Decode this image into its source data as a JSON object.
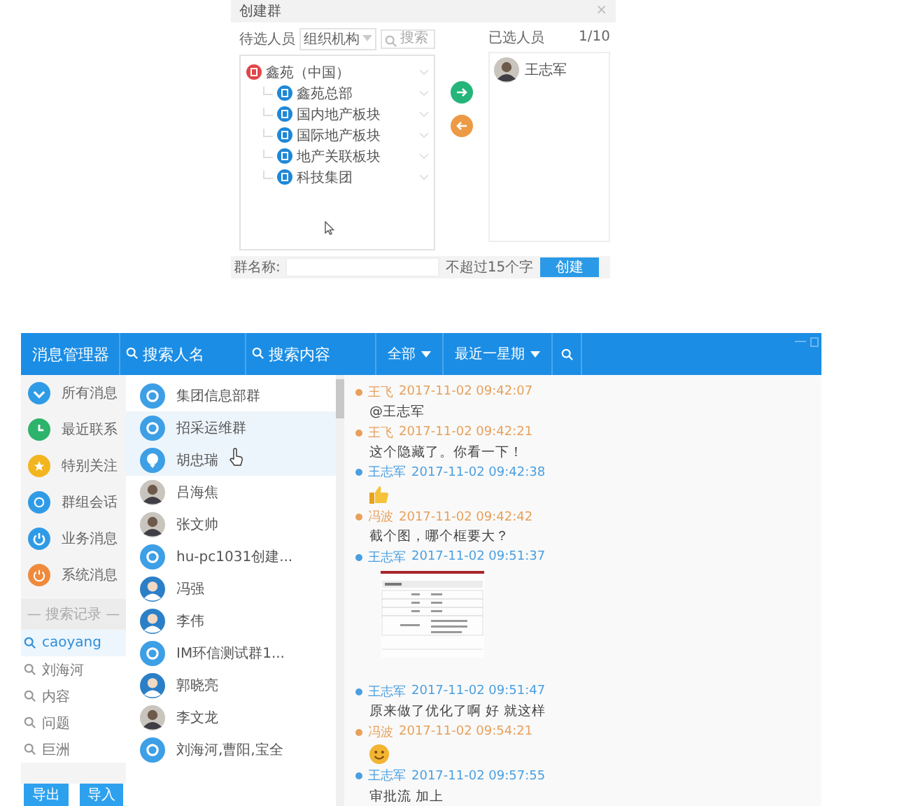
{
  "dialog": {
    "title": "创建群",
    "close": "×",
    "candidates_label": "待选人员",
    "org_select": "组织机构",
    "search": {
      "placeholder": "搜索"
    },
    "tree": [
      {
        "label": "鑫苑（中国）",
        "color": "#e0474c",
        "children": [
          {
            "label": "鑫苑总部",
            "color": "#1e88d8"
          },
          {
            "label": "国内地产板块",
            "color": "#1e88d8"
          },
          {
            "label": "国际地产板块",
            "color": "#1e88d8"
          },
          {
            "label": "地产关联板块",
            "color": "#1e88d8"
          },
          {
            "label": "科技集团",
            "color": "#1e88d8"
          }
        ]
      }
    ],
    "selected_label": "已选人员",
    "selected_count": "1/10",
    "selected_people": [
      {
        "name": "王志军"
      }
    ],
    "group_name_label": "群名称:",
    "group_name_hint": "不超过15个字",
    "create_button": "创建"
  },
  "app": {
    "title": "消息管理器",
    "search_name": {
      "placeholder": "搜索人名"
    },
    "search_content": {
      "placeholder": "搜索内容"
    },
    "filters": [
      {
        "label": "全部"
      },
      {
        "label": "最近一星期"
      }
    ],
    "nav": [
      {
        "label": "所有消息",
        "kind": "all",
        "color": "#2f9be6"
      },
      {
        "label": "最近联系",
        "kind": "recent",
        "color": "#2db36b"
      },
      {
        "label": "特别关注",
        "kind": "star",
        "color": "#f2b51f"
      },
      {
        "label": "群组会话",
        "kind": "group",
        "color": "#2f9be6"
      },
      {
        "label": "业务消息",
        "kind": "business",
        "color": "#2f9be6"
      },
      {
        "label": "系统消息",
        "kind": "system",
        "color": "#ef8a3c"
      }
    ],
    "history_title": "— 搜索记录 —",
    "history": [
      {
        "text": "caoyang",
        "selected": true
      },
      {
        "text": "刘海河",
        "selected": false
      },
      {
        "text": "内容",
        "selected": false
      },
      {
        "text": "问题",
        "selected": false
      },
      {
        "text": "巨洲",
        "selected": false
      }
    ],
    "buttons": [
      {
        "label": "导出"
      },
      {
        "label": "导入"
      }
    ],
    "contacts": [
      {
        "name": "集团信息部群",
        "kind": "group",
        "selected": false
      },
      {
        "name": "招采运维群",
        "kind": "group",
        "selected": true
      },
      {
        "name": "胡忠瑞",
        "kind": "account",
        "selected": true
      },
      {
        "name": "吕海焦",
        "kind": "photo",
        "selected": false
      },
      {
        "name": "张文帅",
        "kind": "photo",
        "selected": false
      },
      {
        "name": "hu-pc1031创建...",
        "kind": "group",
        "selected": false
      },
      {
        "name": "冯强",
        "kind": "person",
        "selected": false
      },
      {
        "name": "李伟",
        "kind": "person",
        "selected": false
      },
      {
        "name": "IM环信测试群1...",
        "kind": "group",
        "selected": false
      },
      {
        "name": "郭晓亮",
        "kind": "person",
        "selected": false
      },
      {
        "name": "李文龙",
        "kind": "photo",
        "selected": false
      },
      {
        "name": "刘海河,曹阳,宝全",
        "kind": "group",
        "selected": false
      }
    ],
    "messages": [
      {
        "sender": "王飞",
        "time": "2017-11-02 09:42:07",
        "color": "#e8a05a",
        "kind": "text",
        "text": "@王志军"
      },
      {
        "sender": "王飞",
        "time": "2017-11-02 09:42:21",
        "color": "#e8a05a",
        "kind": "text",
        "text": "这个隐藏了。你看一下！"
      },
      {
        "sender": "王志军",
        "time": "2017-11-02 09:42:38",
        "color": "#4a9fe0",
        "kind": "thumbs"
      },
      {
        "sender": "冯波",
        "time": "2017-11-02 09:42:42",
        "color": "#e8a05a",
        "kind": "text",
        "text": "截个图，哪个框要大？"
      },
      {
        "sender": "王志军",
        "time": "2017-11-02 09:51:37",
        "color": "#4a9fe0",
        "kind": "image"
      },
      {
        "sender": "王志军",
        "time": "2017-11-02 09:51:47",
        "color": "#4a9fe0",
        "kind": "text",
        "text": "原来做了优化了啊 好 就这样"
      },
      {
        "sender": "冯波",
        "time": "2017-11-02 09:54:21",
        "color": "#e8a05a",
        "kind": "smile"
      },
      {
        "sender": "王志军",
        "time": "2017-11-02 09:57:55",
        "color": "#4a9fe0",
        "kind": "text",
        "text": "审批流 加上"
      }
    ]
  }
}
